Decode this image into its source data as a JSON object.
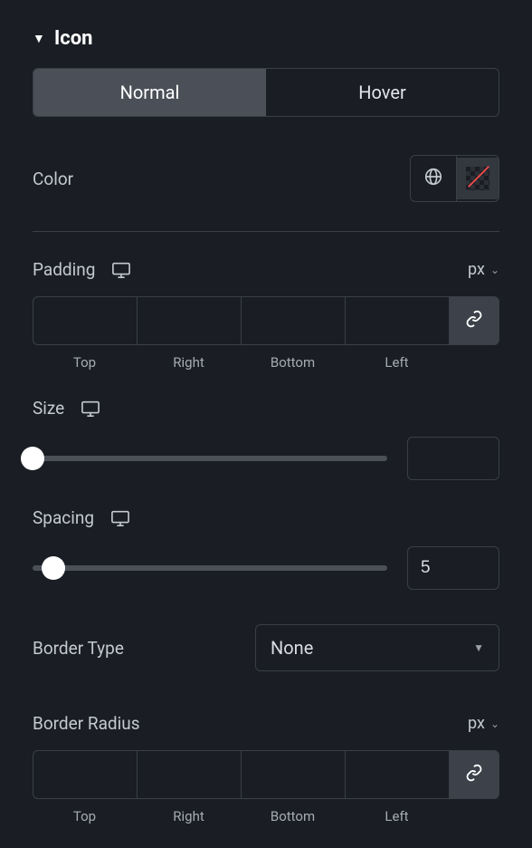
{
  "section": {
    "title": "Icon"
  },
  "tabs": {
    "normal": "Normal",
    "hover": "Hover"
  },
  "color": {
    "label": "Color"
  },
  "padding": {
    "label": "Padding",
    "unit": "px",
    "sides": {
      "top": "Top",
      "right": "Right",
      "bottom": "Bottom",
      "left": "Left"
    }
  },
  "size": {
    "label": "Size",
    "value": ""
  },
  "spacing": {
    "label": "Spacing",
    "value": "5"
  },
  "borderType": {
    "label": "Border Type",
    "value": "None"
  },
  "borderRadius": {
    "label": "Border Radius",
    "unit": "px",
    "sides": {
      "top": "Top",
      "right": "Right",
      "bottom": "Bottom",
      "left": "Left"
    }
  }
}
